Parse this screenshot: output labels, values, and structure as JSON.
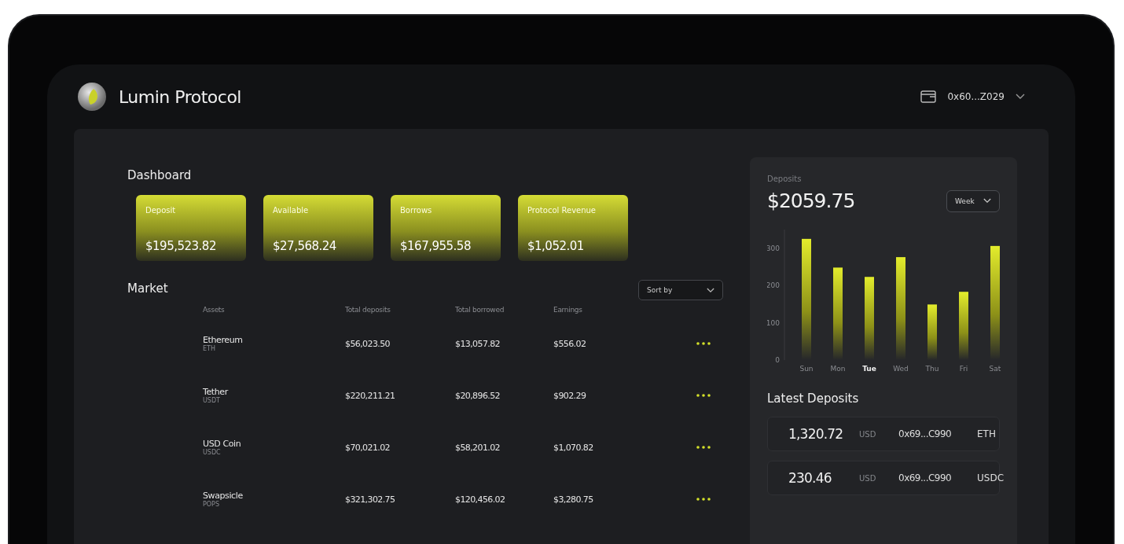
{
  "header": {
    "brand": "Lumin Protocol",
    "wallet": "0x60...Z029"
  },
  "dashboard": {
    "title": "Dashboard",
    "cards": [
      {
        "label": "Deposit",
        "value": "$195,523.82"
      },
      {
        "label": "Available",
        "value": "$27,568.24"
      },
      {
        "label": "Borrows",
        "value": "$167,955.58"
      },
      {
        "label": "Protocol Revenue",
        "value": "$1,052.01"
      }
    ]
  },
  "market": {
    "title": "Market",
    "sort": "Sort by",
    "columns": [
      "Assets",
      "Total deposits",
      "Total borrowed",
      "Earnings"
    ],
    "rows": [
      {
        "name": "Ethereum",
        "symbol": "ETH",
        "deposits": "$56,023.50",
        "borrowed": "$13,057.82",
        "earnings": "$556.02"
      },
      {
        "name": "Tether",
        "symbol": "USDT",
        "deposits": "$220,211.21",
        "borrowed": "$20,896.52",
        "earnings": "$902.29"
      },
      {
        "name": "USD Coin",
        "symbol": "USDC",
        "deposits": "$70,021.02",
        "borrowed": "$58,201.02",
        "earnings": "$1,070.82"
      },
      {
        "name": "Swapsicle",
        "symbol": "POPS",
        "deposits": "$321,302.75",
        "borrowed": "$120,456.02",
        "earnings": "$3,280.75"
      }
    ]
  },
  "deposits": {
    "label": "Deposits",
    "total": "$2059.75",
    "period": "Week",
    "days": [
      {
        "selected": false
      },
      {
        "selected": false
      },
      {
        "selected": true
      },
      {
        "selected": false
      },
      {
        "selected": false
      },
      {
        "selected": false
      },
      {
        "selected": false
      }
    ],
    "chart_data": {
      "type": "bar",
      "categories": [
        "Sun",
        "Mon",
        "Tue",
        "Wed",
        "Thu",
        "Fri",
        "Sat"
      ],
      "values": [
        325,
        248,
        223,
        276,
        149,
        183,
        306
      ],
      "ylim": [
        0,
        350
      ],
      "yticks": [
        0,
        100,
        200,
        300
      ]
    }
  },
  "latest": {
    "title": "Latest Deposits",
    "rows": [
      {
        "amount": "1,320.72",
        "currency": "USD",
        "address": "0x69...C990",
        "asset": "ETH"
      },
      {
        "amount": "230.46",
        "currency": "USD",
        "address": "0x69...C990",
        "asset": "USDC"
      }
    ]
  }
}
